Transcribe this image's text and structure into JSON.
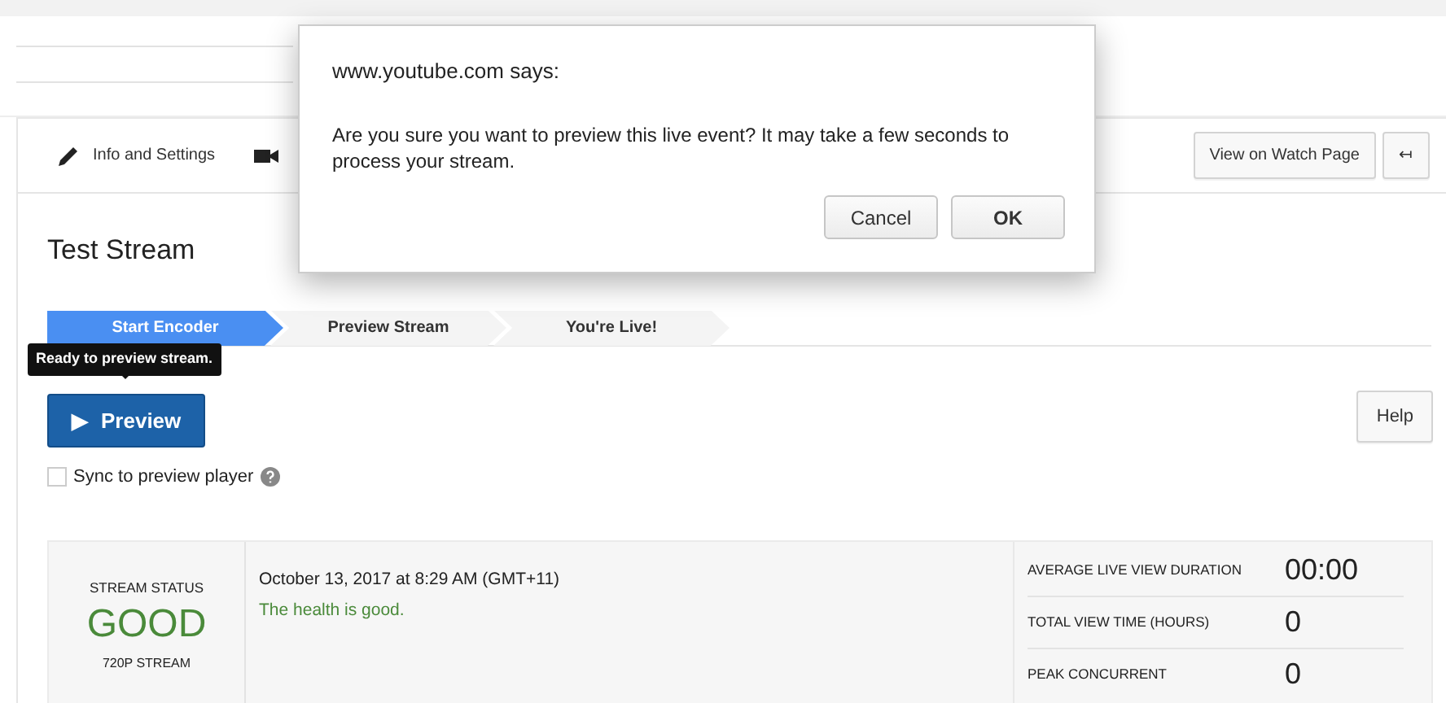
{
  "toolbar": {
    "tabs": [
      {
        "label": "Info and Settings",
        "kind": "tab"
      },
      {
        "kind": "icon"
      }
    ],
    "buttons": [
      {
        "label": "View on Watch Page"
      },
      {
        "label": "↤"
      }
    ]
  },
  "title": "Test Stream",
  "steps": [
    {
      "label": "Start Encoder",
      "selected": true
    },
    {
      "label": "Preview Stream",
      "selected": false
    },
    {
      "label": "You're Live!",
      "selected": false
    }
  ],
  "tooltip": "Ready to preview stream.",
  "preview_button": {
    "label": "Preview",
    "icon": "▶"
  },
  "help_button": "Help",
  "sync": {
    "label": "Sync to preview player",
    "checked": false
  },
  "status": {
    "heading": "STREAM STATUS",
    "value": "GOOD",
    "quality": "720P STREAM",
    "date": "October 13, 2017 at 8:29 AM (GMT+11)",
    "message": "The health is good.",
    "stats": [
      {
        "label": "AVERAGE LIVE VIEW DURATION",
        "value": "00:00"
      },
      {
        "label": "TOTAL VIEW TIME (HOURS)",
        "value": "0"
      },
      {
        "label": "PEAK CONCURRENT",
        "value": "0"
      }
    ]
  },
  "dialog": {
    "title": "www.youtube.com says:",
    "message": "Are you sure you want to preview this live event? It may take a few seconds to process your stream.",
    "buttons": [
      {
        "label": "Cancel",
        "kind": "default"
      },
      {
        "label": "OK",
        "kind": "primary"
      }
    ]
  }
}
